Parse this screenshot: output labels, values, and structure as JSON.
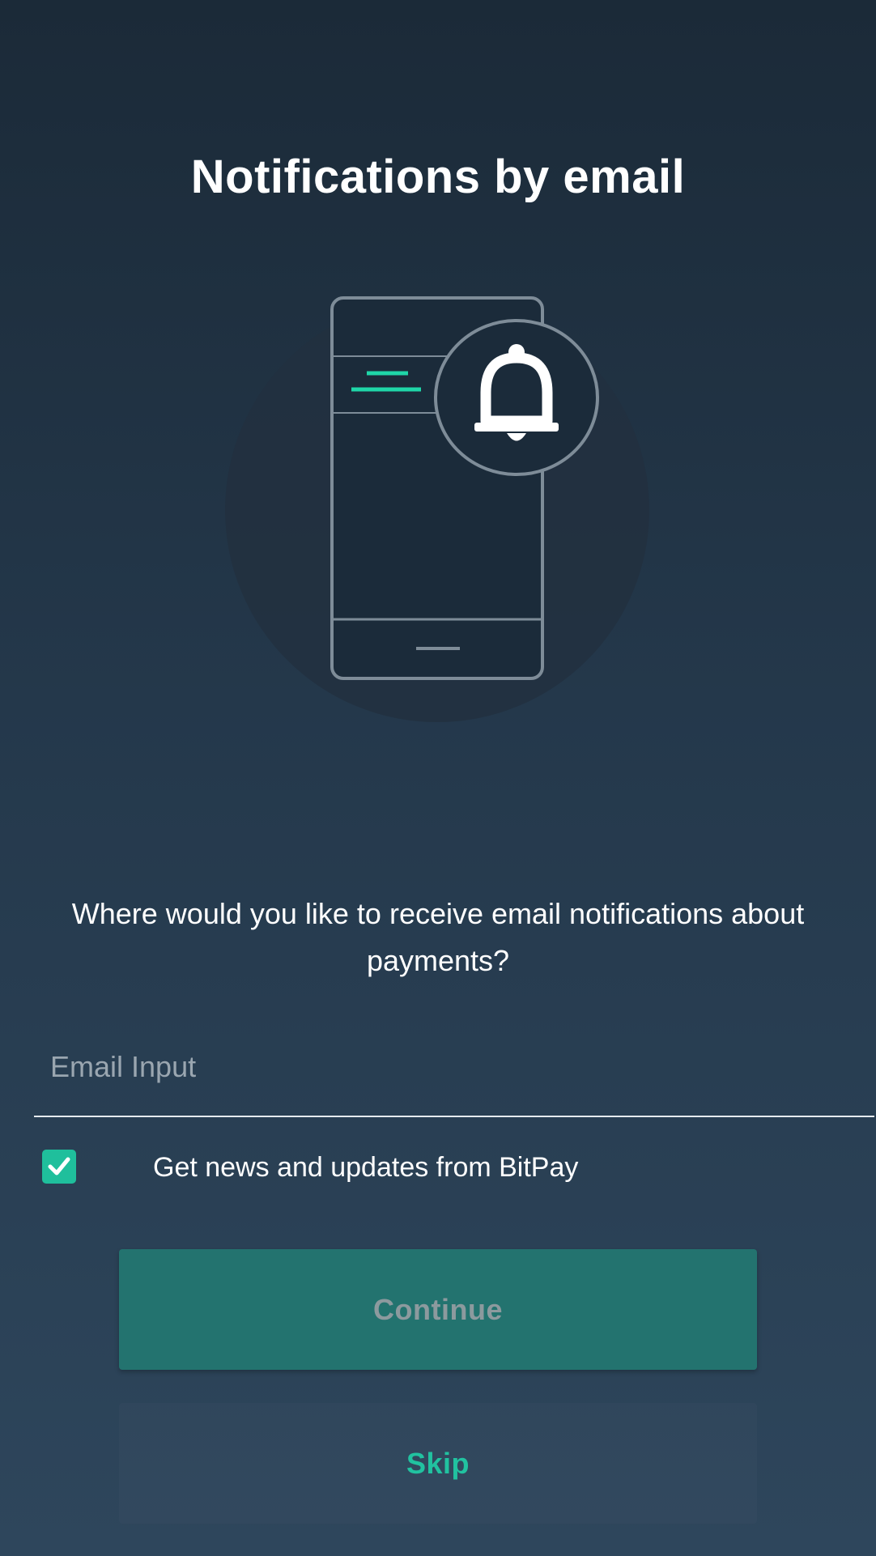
{
  "header": {
    "title": "Notifications by email"
  },
  "illustration": {
    "icon": "phone-with-bell-icon",
    "accent_color": "#1fd6a8",
    "line_color": "#7e8c98"
  },
  "content": {
    "description": "Where would you like to receive email notifications about payments?"
  },
  "form": {
    "email_placeholder": "Email Input",
    "email_value": "",
    "newsletter_checked": true,
    "newsletter_label": "Get news and updates from BitPay"
  },
  "actions": {
    "continue_label": "Continue",
    "skip_label": "Skip"
  },
  "colors": {
    "accent": "#1fbf9c",
    "continue_bg": "#23736f",
    "skip_text": "#21c2a0"
  }
}
